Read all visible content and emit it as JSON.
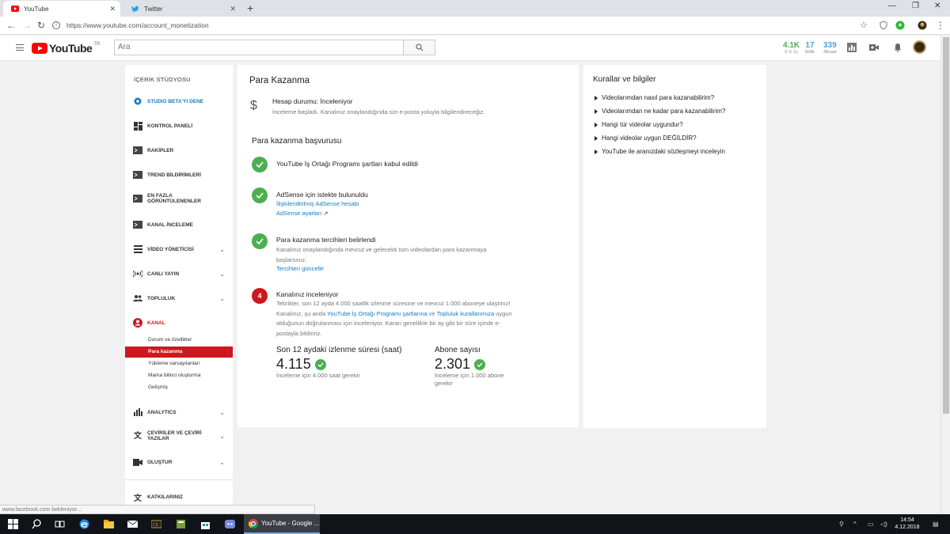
{
  "browser": {
    "tabs": [
      {
        "title": "YouTube",
        "active": true
      },
      {
        "title": "Twitter",
        "active": false
      }
    ],
    "url": "https://www.youtube.com/account_monetization",
    "status_text": "www.facebook.com bekleniyor..."
  },
  "header": {
    "logo_text": "YouTube",
    "country": "TR",
    "search_placeholder": "Ara",
    "stats": [
      {
        "value": "4.1K",
        "label": "5 ⊙ 1y",
        "color": "#4caf50"
      },
      {
        "value": "17",
        "label": "60dk",
        "color": "#4da3d6"
      },
      {
        "value": "339",
        "label": "48saat",
        "color": "#4da3d6"
      }
    ]
  },
  "sidebar": {
    "title": "İÇERİK STÜDYOSU",
    "items": [
      {
        "label": "STUDIO BETA'YI DENE",
        "color": "#167ac6"
      },
      {
        "label": "KONTROL PANELİ"
      },
      {
        "label": "RAKİPLER"
      },
      {
        "label": "TREND BİLDİRİMLERİ"
      },
      {
        "label": "EN FAZLA GÖRÜNTÜLENENLER"
      },
      {
        "label": "KANAL İNCELEME"
      },
      {
        "label": "VİDEO YÖNETİCİSİ"
      },
      {
        "label": "CANLI YAYIN"
      },
      {
        "label": "TOPLULUK"
      },
      {
        "label": "KANAL",
        "color": "#cc181e"
      },
      {
        "label": "ANALYTICS"
      },
      {
        "label": "ÇEVİRİLER VE ÇEVİRİ YAZILAR"
      },
      {
        "label": "OLUŞTUR"
      },
      {
        "label": "KATKILARINIZ"
      }
    ],
    "subitems": [
      "Durum ve özellikler",
      "Para kazanma",
      "Yükleme varsayılanları",
      "Marka bilinci oluşturma",
      "Gelişmiş"
    ]
  },
  "main": {
    "title": "Para Kazanma",
    "account_status": "Hesap durumu: İnceleniyor",
    "account_desc": "İnceleme başladı. Kanalınız onaylandığında sizi e-posta yoluyla bilgilendireceğiz.",
    "apply_title": "Para kazanma başvurusu",
    "steps": [
      {
        "title": "YouTube İş Ortağı Programı şartları kabul edildi"
      },
      {
        "title": "AdSense için istekte bulunuldu",
        "link1": "İlişkilendirilmiş AdSense hesabı",
        "link2": "AdSense ayarları"
      },
      {
        "title": "Para kazanma tercihleri belirlendi",
        "text": "Kanalınız onaylandığında mevcut ve gelecekti tüm videolardan para kazanmaya başlarsınız.",
        "link": "Tercihleri güncelle"
      },
      {
        "number": "4",
        "title": "Kanalınız inceleniyor",
        "text_a": "Tebrikler, son 12 ayda 4.000 saatlik izlenme süresine ve mevcut 1.000 aboneye ulaştınız! Kanalınız, şu anda ",
        "link_a": "YouTube İş Ortağı Programı şartlarına",
        "text_b": " ve ",
        "link_b": "Topluluk kurallarımıza",
        "text_c": " uygun olduğunun doğrulanması için inceleniyor. Kararı genellikle bir ay gibi bir süre içinde e-postayla bildiririz."
      }
    ],
    "metrics": [
      {
        "label": "Son 12 aydaki izlenme süresi (saat)",
        "value": "4.115",
        "note": "İnceleme için 4.000 saat gerekir"
      },
      {
        "label": "Abone sayısı",
        "value": "2.301",
        "note": "İnceleme için 1.000 abone gerekir"
      }
    ]
  },
  "rules": {
    "title": "Kurallar ve bilgiler",
    "items": [
      "Videolarımdan nasıl para kazanabilirim?",
      "Videolarımdan ne kadar para kazanabilirim?",
      "Hangi tür videolar uygundur?",
      "Hangi videolar uygun DEĞİLDİR?",
      "YouTube ile aranızdaki sözleşmeyi inceleyin"
    ]
  },
  "taskbar": {
    "chrome_label": "YouTube - Google ...",
    "time": "14:54",
    "date": "4.12.2018"
  },
  "colors": {
    "accent_red": "#cc181e",
    "link_blue": "#167ac6",
    "ok_green": "#4caf50"
  }
}
